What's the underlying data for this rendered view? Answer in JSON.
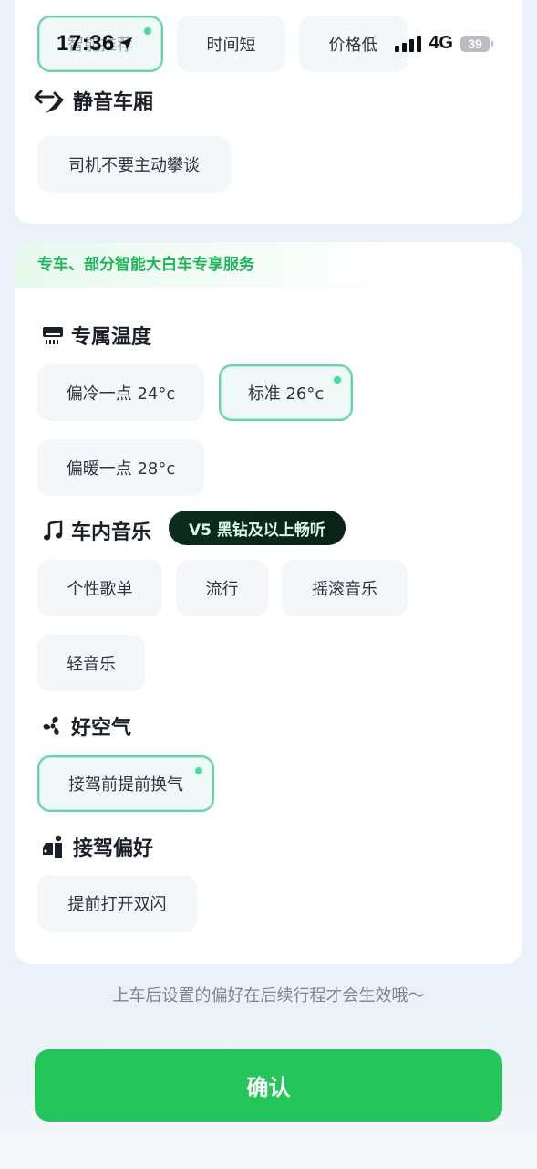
{
  "status_bar": {
    "time": "17:36",
    "network": "4G",
    "battery": "39"
  },
  "route_options": [
    {
      "label": "智能推荐",
      "selected": true
    },
    {
      "label": "时间短",
      "selected": false
    },
    {
      "label": "价格低",
      "selected": false
    }
  ],
  "quiet_cabin": {
    "title": "静音车厢",
    "options": [
      {
        "label": "司机不要主动攀谈",
        "selected": false
      }
    ]
  },
  "premium_banner": "专车、部分智能大白车专享服务",
  "temperature": {
    "title": "专属温度",
    "options": [
      {
        "label": "偏冷一点 24°c",
        "selected": false
      },
      {
        "label": "标准 26°c",
        "selected": true
      },
      {
        "label": "偏暖一点 28°c",
        "selected": false
      }
    ]
  },
  "music": {
    "title": "车内音乐",
    "vip_badge": "V5 黑钻及以上畅听",
    "options": [
      {
        "label": "个性歌单",
        "selected": false
      },
      {
        "label": "流行",
        "selected": false
      },
      {
        "label": "摇滚音乐",
        "selected": false
      },
      {
        "label": "轻音乐",
        "selected": false
      }
    ]
  },
  "air": {
    "title": "好空气",
    "options": [
      {
        "label": "接驾前提前换气",
        "selected": true
      }
    ]
  },
  "pickup": {
    "title": "接驾偏好",
    "options": [
      {
        "label": "提前打开双闪",
        "selected": false
      }
    ]
  },
  "hint": "上车后设置的偏好在后续行程才会生效哦～",
  "confirm_label": "确认",
  "colors": {
    "accent_green": "#24c55a",
    "selected_border": "#67d3a8",
    "chip_bg": "#f4f7fa",
    "page_bg": "#eaf1f8"
  }
}
